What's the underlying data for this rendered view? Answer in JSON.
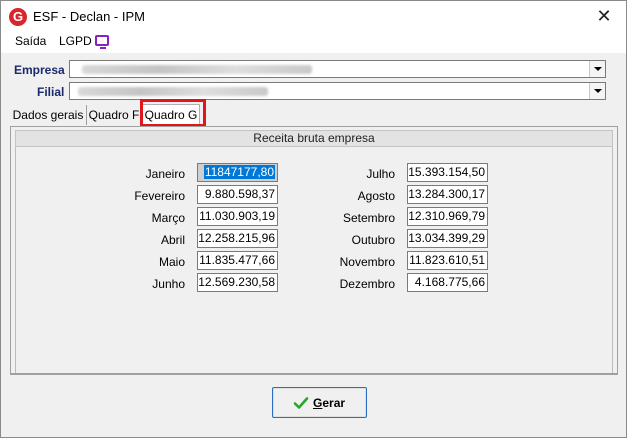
{
  "window": {
    "title": "ESF - Declan - IPM",
    "app_icon_glyph": "G"
  },
  "menu": {
    "items": [
      "Saída",
      "LGPD"
    ],
    "lgpd_icon": "monitor-icon"
  },
  "fields": {
    "empresa_label": "Empresa",
    "filial_label": "Filial"
  },
  "tabs": [
    "Dados gerais",
    "Quadro F",
    "Quadro G"
  ],
  "active_tab": "Quadro G",
  "section_title": "Receita bruta empresa",
  "months_left": [
    {
      "label": "Janeiro",
      "value": "11847177,80"
    },
    {
      "label": "Fevereiro",
      "value": "9.880.598,37"
    },
    {
      "label": "Março",
      "value": "11.030.903,19"
    },
    {
      "label": "Abril",
      "value": "12.258.215,96"
    },
    {
      "label": "Maio",
      "value": "11.835.477,66"
    },
    {
      "label": "Junho",
      "value": "12.569.230,58"
    }
  ],
  "months_right": [
    {
      "label": "Julho",
      "value": "15.393.154,50"
    },
    {
      "label": "Agosto",
      "value": "13.284.300,17"
    },
    {
      "label": "Setembro",
      "value": "12.310.969,79"
    },
    {
      "label": "Outubro",
      "value": "13.034.399,29"
    },
    {
      "label": "Novembro",
      "value": "11.823.610,51"
    },
    {
      "label": "Dezembro",
      "value": "4.168.775,66"
    }
  ],
  "button": {
    "gerar_label": "Gerar"
  },
  "colors": {
    "highlight": "#e0161b",
    "label_blue": "#1a2a6c",
    "selection": "#0078d7",
    "check_green": "#2aa52a"
  }
}
